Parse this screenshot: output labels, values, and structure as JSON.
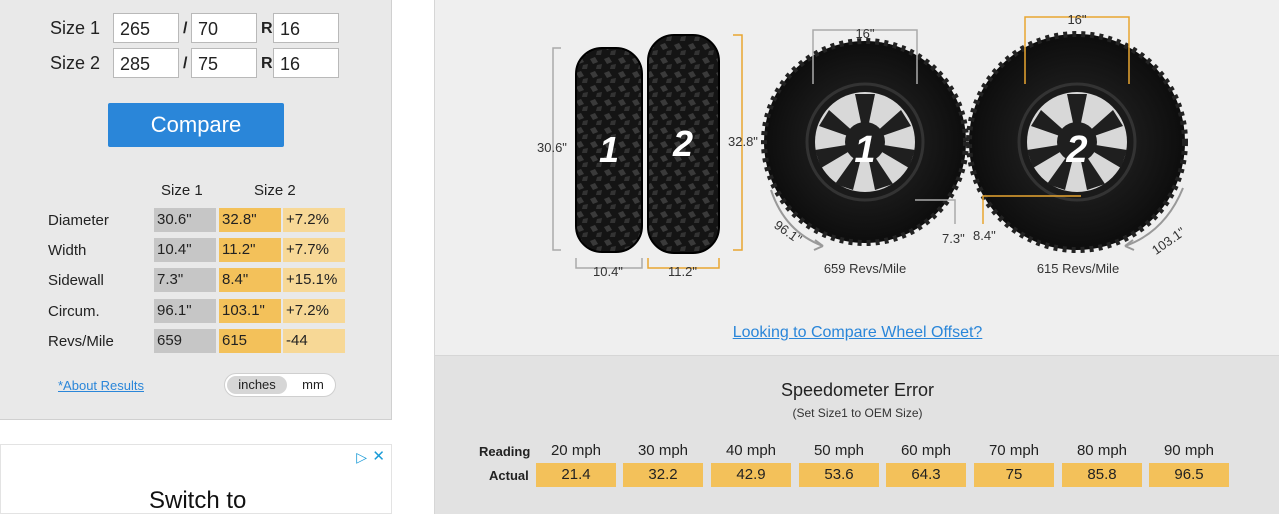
{
  "form": {
    "size1": {
      "label": "Size 1",
      "width": "265",
      "aspect": "70",
      "rim": "16"
    },
    "size2": {
      "label": "Size 2",
      "width": "285",
      "aspect": "75",
      "rim": "16"
    },
    "slash": "/",
    "r": "R",
    "compare_label": "Compare"
  },
  "results": {
    "col_size1": "Size 1",
    "col_size2": "Size 2",
    "rows": [
      {
        "label": "Diameter",
        "s1": "30.6\"",
        "s2": "32.8\"",
        "diff": "+7.2%"
      },
      {
        "label": "Width",
        "s1": "10.4\"",
        "s2": "11.2\"",
        "diff": "+7.7%"
      },
      {
        "label": "Sidewall",
        "s1": "7.3\"",
        "s2": "8.4\"",
        "diff": "+15.1%"
      },
      {
        "label": "Circum.",
        "s1": "96.1\"",
        "s2": "103.1\"",
        "diff": "+7.2%"
      },
      {
        "label": "Revs/Mile",
        "s1": "659",
        "s2": "615",
        "diff": "-44"
      }
    ],
    "about_link": "*About Results",
    "unit_inches": "inches",
    "unit_mm": "mm"
  },
  "ad": {
    "text": "Switch to"
  },
  "diagram": {
    "tire1_num": "1",
    "tire2_num": "2",
    "tire1_diameter": "30.6\"",
    "tire2_diameter": "32.8\"",
    "tire1_width": "10.4\"",
    "tire2_width": "11.2\"",
    "wheel1_rim": "16\"",
    "wheel2_rim": "16\"",
    "wheel1_sidewall": "7.3\"",
    "wheel2_sidewall": "8.4\"",
    "wheel1_circ": "96.1\"",
    "wheel2_circ": "103.1\"",
    "wheel1_revs": "659 Revs/Mile",
    "wheel2_revs": "615 Revs/Mile"
  },
  "offset_link": "Looking to Compare Wheel Offset?",
  "speedo": {
    "title": "Speedometer Error",
    "subtitle": "(Set Size1 to OEM Size)",
    "reading_label": "Reading",
    "actual_label": "Actual",
    "readings": [
      "20 mph",
      "30 mph",
      "40 mph",
      "50 mph",
      "60 mph",
      "70 mph",
      "80 mph",
      "90 mph"
    ],
    "actuals": [
      "21.4",
      "32.2",
      "42.9",
      "53.6",
      "64.3",
      "75",
      "85.8",
      "96.5"
    ]
  },
  "colors": {
    "accent": "#2a86d9",
    "size2": "#f3c15a",
    "size1": "#c6c6c6",
    "dim_line": "#e8a531"
  }
}
